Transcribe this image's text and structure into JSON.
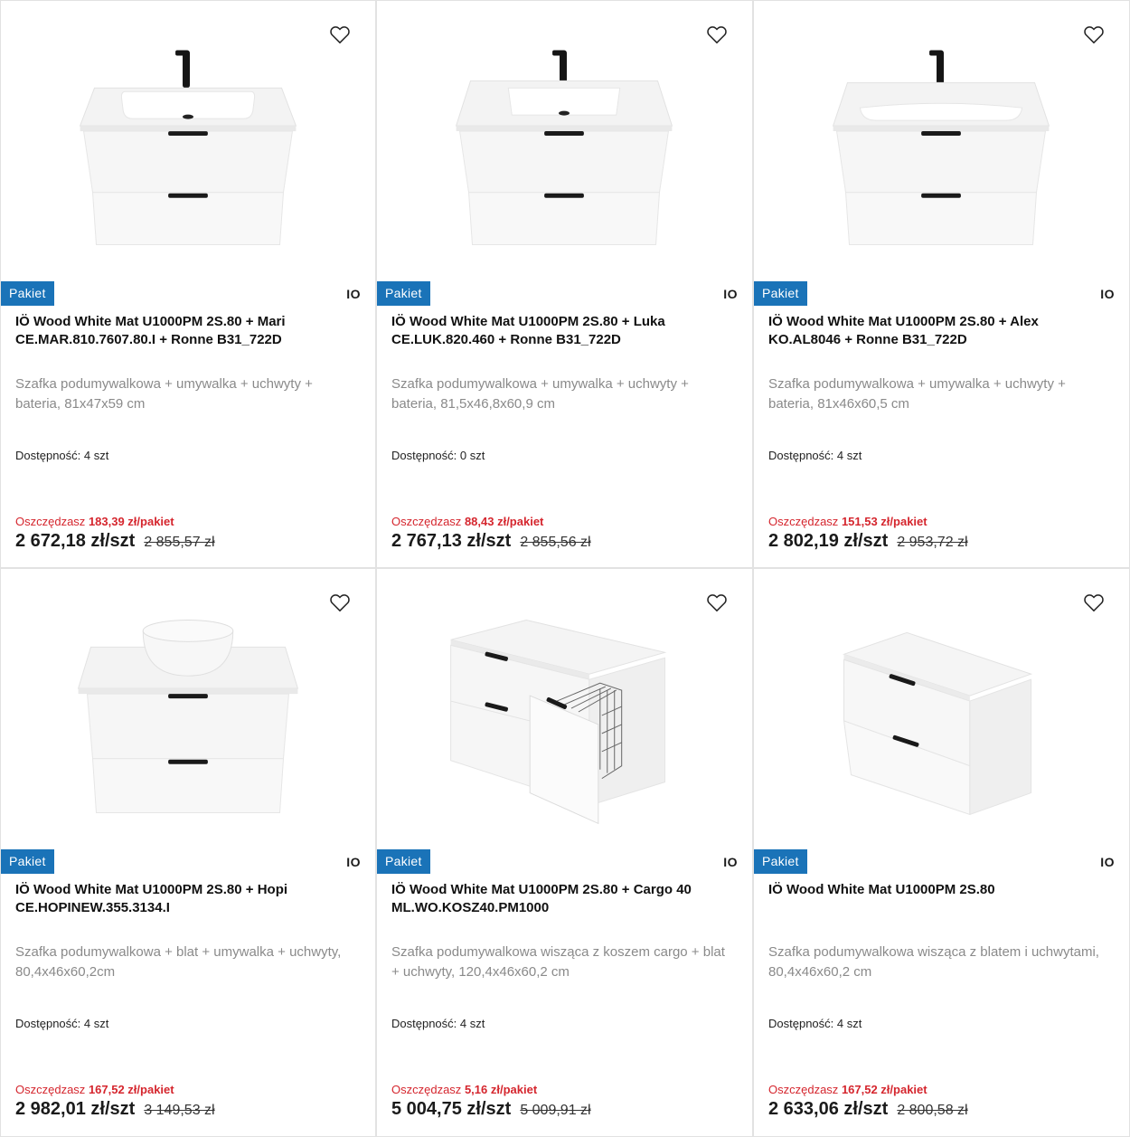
{
  "products": [
    {
      "badge": "Pakiet",
      "brand": "IO",
      "title": "IÖ Wood White Mat U1000PM 2S.80 + Mari CE.MAR.810.7607.80.I + Ronne B31_722D",
      "description": "Szafka podumywalkowa + umywalka + uchwyty + bateria, 81x47x59 cm",
      "availability": "Dostępność: 4 szt",
      "save_label": "Oszczędzasz",
      "save_amount": "183,39 zł/pakiet",
      "price": "2 672,18 zł/szt",
      "old_price": "2 855,57 zł",
      "image_icon": "vanity-basin-icon"
    },
    {
      "badge": "Pakiet",
      "brand": "IO",
      "title": "IÖ Wood White Mat U1000PM 2S.80 + Luka CE.LUK.820.460 + Ronne B31_722D",
      "description": "Szafka podumywalkowa + umywalka + uchwyty + bateria, 81,5x46,8x60,9 cm",
      "availability": "Dostępność: 0 szt",
      "save_label": "Oszczędzasz",
      "save_amount": "88,43 zł/pakiet",
      "price": "2 767,13 zł/szt",
      "old_price": "2 855,56 zł",
      "image_icon": "vanity-basin-icon"
    },
    {
      "badge": "Pakiet",
      "brand": "IO",
      "title": "IÖ Wood White Mat U1000PM 2S.80 + Alex KO.AL8046 + Ronne B31_722D",
      "description": "Szafka podumywalkowa + umywalka + uchwyty + bateria, 81x46x60,5 cm",
      "availability": "Dostępność: 4 szt",
      "save_label": "Oszczędzasz",
      "save_amount": "151,53 zł/pakiet",
      "price": "2 802,19 zł/szt",
      "old_price": "2 953,72 zł",
      "image_icon": "vanity-basin-icon"
    },
    {
      "badge": "Pakiet",
      "brand": "IO",
      "title": "IÖ Wood White Mat U1000PM 2S.80 + Hopi CE.HOPINEW.355.3134.I",
      "description": "Szafka podumywalkowa + blat + umywalka + uchwyty, 80,4x46x60,2cm",
      "availability": "Dostępność: 4 szt",
      "save_label": "Oszczędzasz",
      "save_amount": "167,52 zł/pakiet",
      "price": "2 982,01 zł/szt",
      "old_price": "3 149,53 zł",
      "image_icon": "vanity-bowl-icon"
    },
    {
      "badge": "Pakiet",
      "brand": "IO",
      "title": "IÖ Wood White Mat U1000PM 2S.80 + Cargo 40 ML.WO.KOSZ40.PM1000",
      "description": "Szafka podumywalkowa wisząca z koszem cargo + blat + uchwyty, 120,4x46x60,2 cm",
      "availability": "Dostępność: 4 szt",
      "save_label": "Oszczędzasz",
      "save_amount": "5,16 zł/pakiet",
      "price": "5 004,75 zł/szt",
      "old_price": "5 009,91 zł",
      "image_icon": "cabinet-cargo-icon"
    },
    {
      "badge": "Pakiet",
      "brand": "IO",
      "title": "IÖ Wood White Mat U1000PM 2S.80",
      "description": "Szafka podumywalkowa wisząca z blatem i uchwytami, 80,4x46x60,2 cm",
      "availability": "Dostępność: 4 szt",
      "save_label": "Oszczędzasz",
      "save_amount": "167,52 zł/pakiet",
      "price": "2 633,06 zł/szt",
      "old_price": "2 800,58 zł",
      "image_icon": "cabinet-icon"
    }
  ],
  "colors": {
    "badge": "#1a73b8",
    "save": "#d5262e"
  }
}
